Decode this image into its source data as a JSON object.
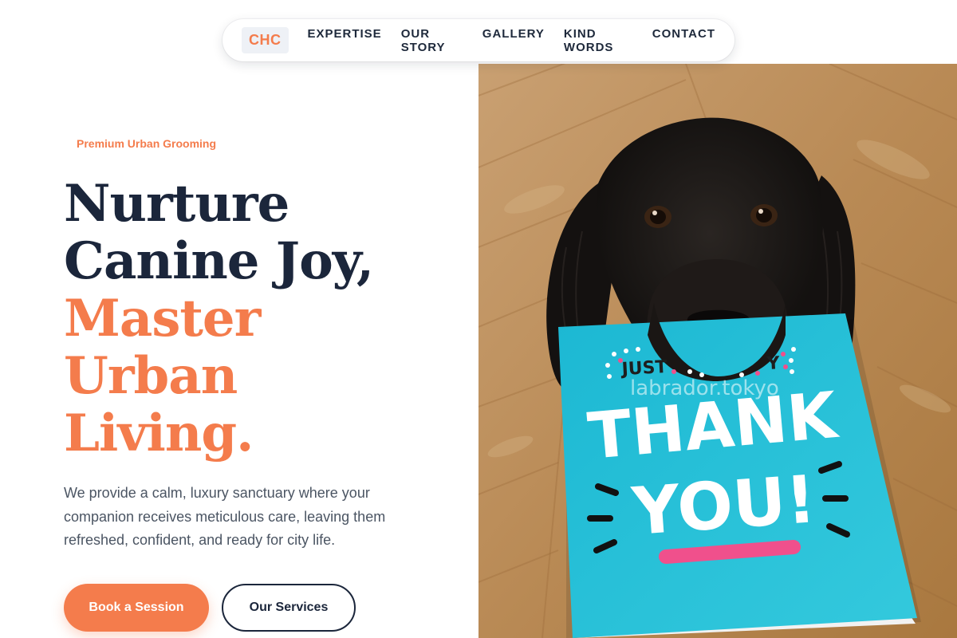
{
  "nav": {
    "logo": "CHC",
    "links": [
      "EXPERTISE",
      "OUR STORY",
      "GALLERY",
      "KIND WORDS",
      "CONTACT"
    ]
  },
  "hero": {
    "eyebrow": "Premium Urban Grooming",
    "headline_dark": [
      "Nurture",
      "Canine Joy,"
    ],
    "headline_accent": [
      "Master",
      "Urban",
      "Living."
    ],
    "description": "We provide a calm, luxury sanctuary where your companion receives meticulous care, leaving them refreshed, confident, and ready for city life.",
    "primary_button": "Book a Session",
    "secondary_button": "Our Services"
  },
  "photo": {
    "card_top_text": "JUST",
    "card_top_text_right": "Y",
    "card_line_1": "THANK",
    "card_line_2": "YOU!",
    "watermark": "labrador.tokyo"
  },
  "colors": {
    "accent": "#f47c4c",
    "navy": "#1b263b",
    "body_text": "#4b5563",
    "card": "#2ec4d9",
    "floor": "#b7864f",
    "underline": "#f0508c"
  }
}
